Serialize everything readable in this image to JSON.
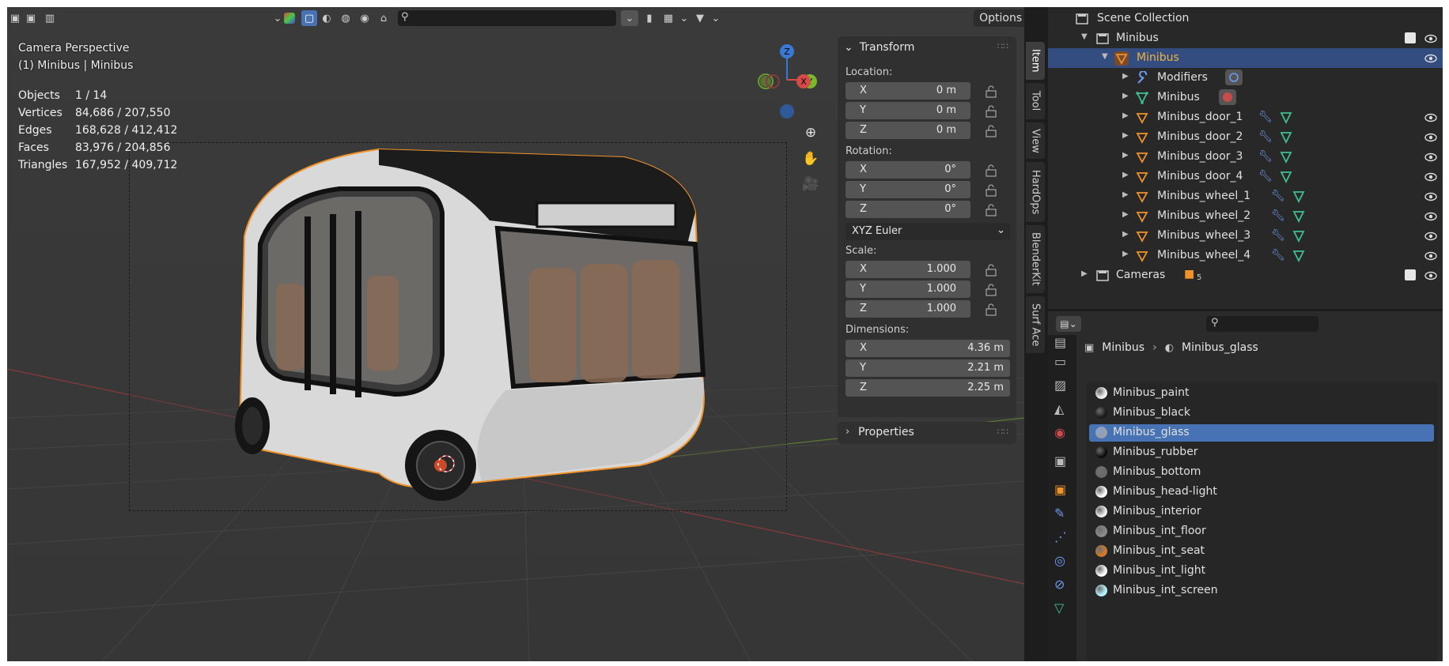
{
  "viewport": {
    "info": {
      "view_name": "Camera Perspective",
      "object_line": "(1) Minibus | Minibus"
    },
    "stats": [
      {
        "label": "Objects",
        "value": "1 / 14"
      },
      {
        "label": "Vertices",
        "value": "84,686 / 207,550"
      },
      {
        "label": "Edges",
        "value": "168,628 / 412,412"
      },
      {
        "label": "Faces",
        "value": "83,976 / 204,856"
      },
      {
        "label": "Triangles",
        "value": "167,952 / 409,712"
      }
    ],
    "header": {
      "options_label": "Options"
    },
    "gizmo": {
      "z": "Z",
      "x": "X",
      "y": "Y"
    }
  },
  "npanel": {
    "transform_title": "Transform",
    "location_label": "Location:",
    "location": [
      {
        "axis": "X",
        "value": "0 m"
      },
      {
        "axis": "Y",
        "value": "0 m"
      },
      {
        "axis": "Z",
        "value": "0 m"
      }
    ],
    "rotation_label": "Rotation:",
    "rotation": [
      {
        "axis": "X",
        "value": "0°"
      },
      {
        "axis": "Y",
        "value": "0°"
      },
      {
        "axis": "Z",
        "value": "0°"
      }
    ],
    "rotation_mode": "XYZ Euler",
    "scale_label": "Scale:",
    "scale": [
      {
        "axis": "X",
        "value": "1.000"
      },
      {
        "axis": "Y",
        "value": "1.000"
      },
      {
        "axis": "Z",
        "value": "1.000"
      }
    ],
    "dimensions_label": "Dimensions:",
    "dimensions": [
      {
        "axis": "X",
        "value": "4.36 m"
      },
      {
        "axis": "Y",
        "value": "2.21 m"
      },
      {
        "axis": "Z",
        "value": "2.25 m"
      }
    ],
    "properties_title": "Properties"
  },
  "side_tabs": [
    "Item",
    "Tool",
    "View",
    "HardOps",
    "BlenderKit",
    "Surf Ace"
  ],
  "outliner": {
    "root": "Scene Collection",
    "collection": "Minibus",
    "object": "Minibus",
    "modifiers": "Modifiers",
    "mesh": "Minibus",
    "children": [
      "Minibus_door_1",
      "Minibus_door_2",
      "Minibus_door_3",
      "Minibus_door_4",
      "Minibus_wheel_1",
      "Minibus_wheel_2",
      "Minibus_wheel_3",
      "Minibus_wheel_4"
    ],
    "cameras": "Cameras",
    "cameras_count": "5"
  },
  "properties": {
    "breadcrumb_object": "Minibus",
    "breadcrumb_material": "Minibus_glass",
    "materials": [
      {
        "name": "Minibus_paint",
        "color": "#f2f2f2"
      },
      {
        "name": "Minibus_black",
        "color": "#1a1a1a"
      },
      {
        "name": "Minibus_glass",
        "color": "#9aa0a8"
      },
      {
        "name": "Minibus_rubber",
        "color": "#0d0d0d"
      },
      {
        "name": "Minibus_bottom",
        "color": "#6a6a6a"
      },
      {
        "name": "Minibus_head-light",
        "color": "#ffffff"
      },
      {
        "name": "Minibus_interior",
        "color": "#f0f0f0"
      },
      {
        "name": "Minibus_int_floor",
        "color": "#8a8a8a"
      },
      {
        "name": "Minibus_int_seat",
        "color": "#d07a2a"
      },
      {
        "name": "Minibus_int_light",
        "color": "#ffffff"
      },
      {
        "name": "Minibus_int_screen",
        "color": "#b8f4ff"
      }
    ],
    "selected_material": "Minibus_glass"
  },
  "colors": {
    "selection": "#334d80",
    "active_material": "#4772b3",
    "object_orange": "#f0932b",
    "modifier_blue": "#6e9cf2",
    "mesh_green": "#3fbf8f"
  }
}
